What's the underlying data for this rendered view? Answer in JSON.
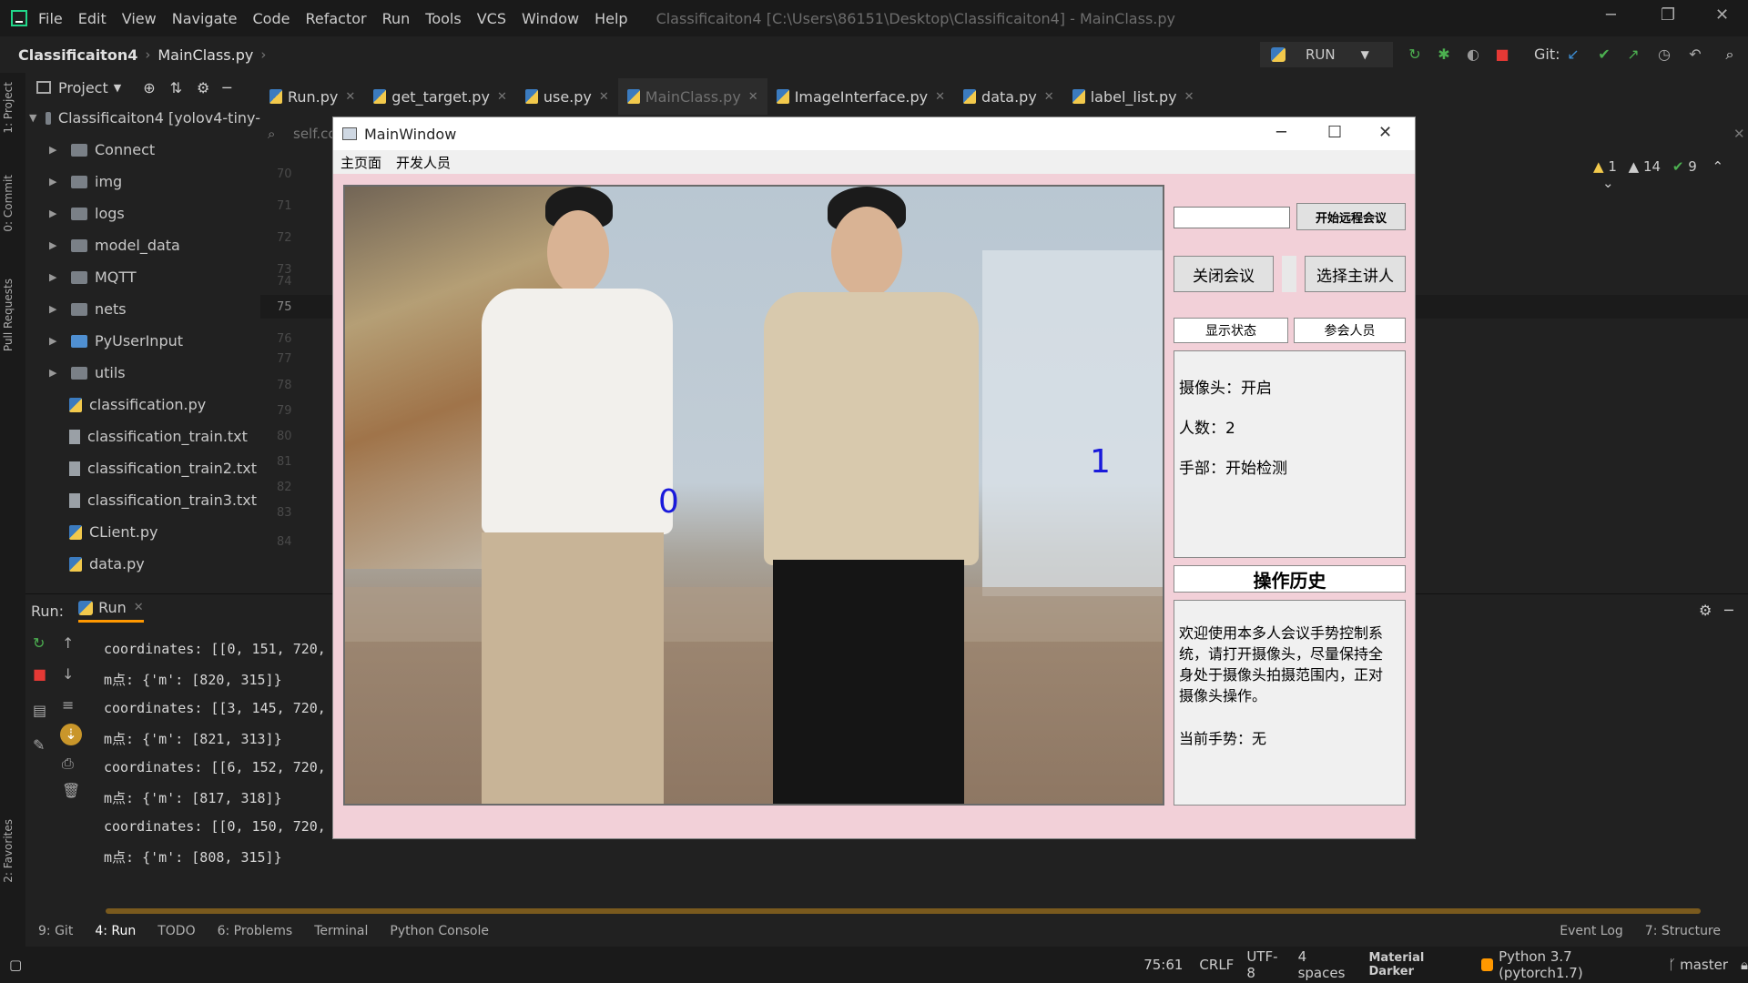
{
  "ide": {
    "menu": [
      "File",
      "Edit",
      "View",
      "Navigate",
      "Code",
      "Refactor",
      "Run",
      "Tools",
      "VCS",
      "Window",
      "Help"
    ],
    "window_title": "Classificaiton4 [C:\\Users\\86151\\Desktop\\Classificaiton4] - MainClass.py",
    "breadcrumb": {
      "project": "Classificaiton4",
      "file": "MainClass.py"
    },
    "run_config": "RUN",
    "git_label": "Git:",
    "project_panel": {
      "title": "Project",
      "root": "Classificaiton4 [yolov4-tiny-",
      "folders": [
        "Connect",
        "img",
        "logs",
        "model_data",
        "MQTT",
        "nets",
        "PyUserInput",
        "utils"
      ],
      "files": [
        "classification.py",
        "classification_train.txt",
        "classification_train2.txt",
        "classification_train3.txt",
        "CLient.py",
        "data.py"
      ]
    },
    "tabs": [
      "Run.py",
      "get_target.py",
      "use.py",
      "MainClass.py",
      "ImageInterface.py",
      "data.py",
      "label_list.py"
    ],
    "editor": {
      "search_text": "self.co",
      "line_numbers": [
        "70",
        "71",
        "72",
        "73",
        "74",
        "75",
        "76",
        "77",
        "78",
        "79",
        "80",
        "81",
        "82",
        "83",
        "84"
      ],
      "inspection": {
        "warn1": "1",
        "warn2": "14",
        "ok": "9"
      }
    },
    "run_panel": {
      "label": "Run:",
      "tab": "Run",
      "lines": [
        "coordinates: [[0, 151, 720,",
        "m点: {'m': [820, 315]}",
        "coordinates: [[3, 145, 720,",
        "m点: {'m': [821, 313]}",
        "coordinates: [[6, 152, 720,",
        "m点: {'m': [817, 318]}",
        "coordinates: [[0, 150, 720,",
        "m点: {'m': [808, 315]}"
      ]
    },
    "tool_tabs": [
      "9: Git",
      "4: Run",
      "TODO",
      "6: Problems",
      "Terminal",
      "Python Console"
    ],
    "tool_tabs_right": [
      "Event Log",
      "7: Structure"
    ],
    "status": {
      "position": "75:61",
      "line_sep": "CRLF",
      "encoding": "UTF-8",
      "indent": "4 spaces",
      "theme": "Material Darker",
      "interpreter": "Python 3.7 (pytorch1.7)",
      "branch": "master"
    },
    "left_strip": [
      "1: Project",
      "0: Commit",
      "Pull Requests",
      "2: Favorites"
    ]
  },
  "qt": {
    "title": "MainWindow",
    "menu": [
      "主页面",
      "开发人员"
    ],
    "video_labels": [
      "0",
      "1"
    ],
    "start_meeting": "开始远程会议",
    "close_meeting": "关闭会议",
    "select_speaker": "选择主讲人",
    "show_status": "显示状态",
    "participants": "参会人员",
    "status": {
      "camera": "摄像头：开启",
      "count": "人数：2",
      "hand": "手部：开始检测"
    },
    "history_title": "操作历史",
    "history_text": "欢迎使用本多人会议手势控制系统，请打开摄像头，尽量保持全身处于摄像头拍摄范围内，正对摄像头操作。",
    "current_gesture": "当前手势：无"
  }
}
